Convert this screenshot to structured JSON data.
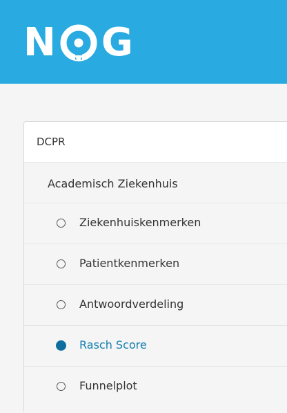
{
  "brand": {
    "logo_text": "NOG",
    "header_color": "#29aae1"
  },
  "panel": {
    "title": "DCPR",
    "section_title": "Academisch Ziekenhuis",
    "items": [
      {
        "label": "Ziekenhuiskenmerken",
        "selected": false
      },
      {
        "label": "Patientkenmerken",
        "selected": false
      },
      {
        "label": "Antwoordverdeling",
        "selected": false
      },
      {
        "label": "Rasch Score",
        "selected": true
      },
      {
        "label": "Funnelplot",
        "selected": false
      }
    ]
  },
  "colors": {
    "active_text": "#137eaf",
    "active_radio": "#0f6e9d"
  }
}
